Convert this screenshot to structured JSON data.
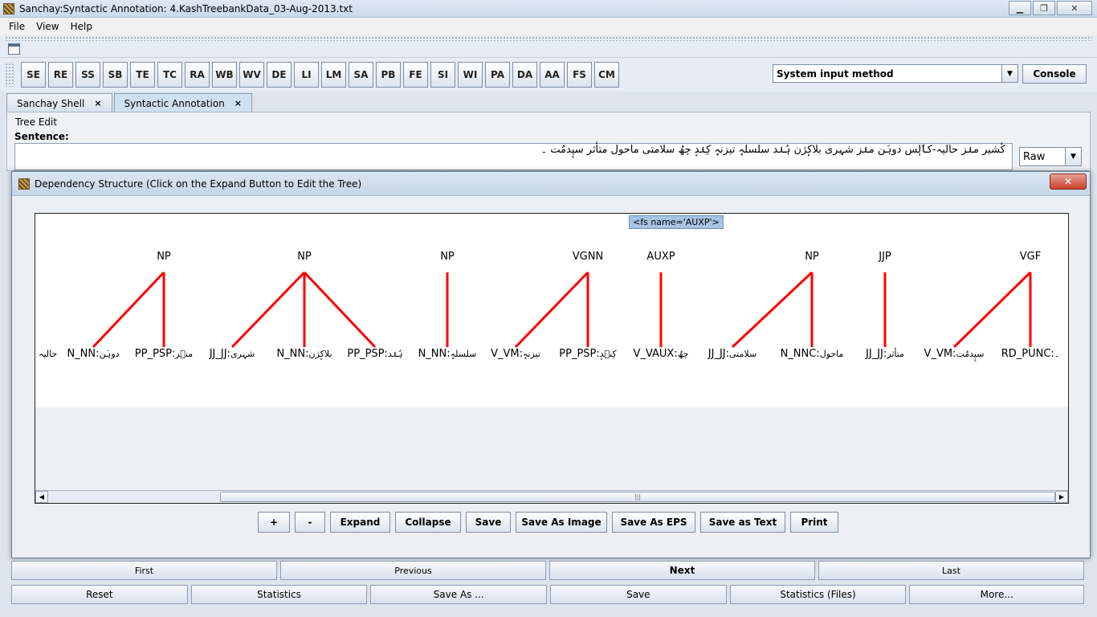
{
  "window": {
    "title": "Sanchay:Syntactic Annotation: 4.KashTreebankData_03-Aug-2013.txt"
  },
  "menu": [
    "File",
    "View",
    "Help"
  ],
  "toolbar": {
    "buttons": [
      "SE",
      "RE",
      "SS",
      "SB",
      "TE",
      "TC",
      "RA",
      "WB",
      "WV",
      "DE",
      "LI",
      "LM",
      "SA",
      "PB",
      "FE",
      "SI",
      "WI",
      "PA",
      "DA",
      "AA",
      "FS",
      "CM"
    ],
    "input_method": "System input method",
    "console_label": "Console"
  },
  "tabs": [
    {
      "label": "Sanchay Shell",
      "close": "×"
    },
    {
      "label": "Syntactic Annotation",
      "close": "×"
    }
  ],
  "tree_edit": {
    "group_title": "Tree Edit",
    "sentence_label": "Sentence:",
    "sentence_text": "کٔشیر منٛز حالیہ-کٲلٕس دوہَن منٛز شہری بلاکٕژن ہُنٛد سلسلہٕ تیزنہٕ کِنٛدٕ چھُ سلامتی ماحول متأثر سپٕدمُت ۔",
    "format_value": "Raw"
  },
  "dialog": {
    "title": "Dependency Structure (Click on the Expand Button to Edit the Tree)",
    "close": "✕",
    "fs_tag": "<fs name='AUXP'>",
    "buttons": [
      "+",
      "-",
      "Expand",
      "Collapse",
      "Save",
      "Save As Image",
      "Save As EPS",
      "Save as Text",
      "Print"
    ]
  },
  "tree": {
    "phrases": [
      "NP",
      "NP",
      "NP",
      "VGNN",
      "AUXP",
      "NP",
      "JJP",
      "VGF"
    ],
    "leaves": [
      {
        "tag": "",
        "word": "حالیہ"
      },
      {
        "tag": "N_NN:",
        "word": "دوہَن"
      },
      {
        "tag": "PP_PSP:",
        "word": "منٛز"
      },
      {
        "tag": "JJ_JJ:",
        "word": "شہری"
      },
      {
        "tag": "N_NN:",
        "word": "بلاکٕژن"
      },
      {
        "tag": "PP_PSP:",
        "word": "ہُنٛد"
      },
      {
        "tag": "N_NN:",
        "word": "سلسلہٕ"
      },
      {
        "tag": "V_VM:",
        "word": "تیزنہٕ"
      },
      {
        "tag": "PP_PSP:",
        "word": "کِنٛدٕ"
      },
      {
        "tag": "V_VAUX:",
        "word": "چھُ"
      },
      {
        "tag": "JJ_JJ:",
        "word": "سلامتی"
      },
      {
        "tag": "N_NNC:",
        "word": "ماحول"
      },
      {
        "tag": "JJ_JJ:",
        "word": "متأثر"
      },
      {
        "tag": "V_VM:",
        "word": "سپٕدمُت"
      },
      {
        "tag": "RD_PUNC:",
        "word": "۔"
      }
    ],
    "edges": [
      [
        0,
        1
      ],
      [
        0,
        2
      ],
      [
        1,
        3
      ],
      [
        1,
        4
      ],
      [
        1,
        5
      ],
      [
        2,
        6
      ],
      [
        3,
        7
      ],
      [
        3,
        8
      ],
      [
        4,
        9
      ],
      [
        5,
        10
      ],
      [
        5,
        11
      ],
      [
        6,
        12
      ],
      [
        7,
        13
      ],
      [
        7,
        14
      ]
    ],
    "edge_color": "#ff0000"
  },
  "navigation": {
    "row1": [
      "First",
      "Previous",
      "Next",
      "Last"
    ],
    "row2": [
      "Reset",
      "Statistics",
      "Save As ...",
      "Save",
      "Statistics (Files)",
      "More..."
    ]
  }
}
